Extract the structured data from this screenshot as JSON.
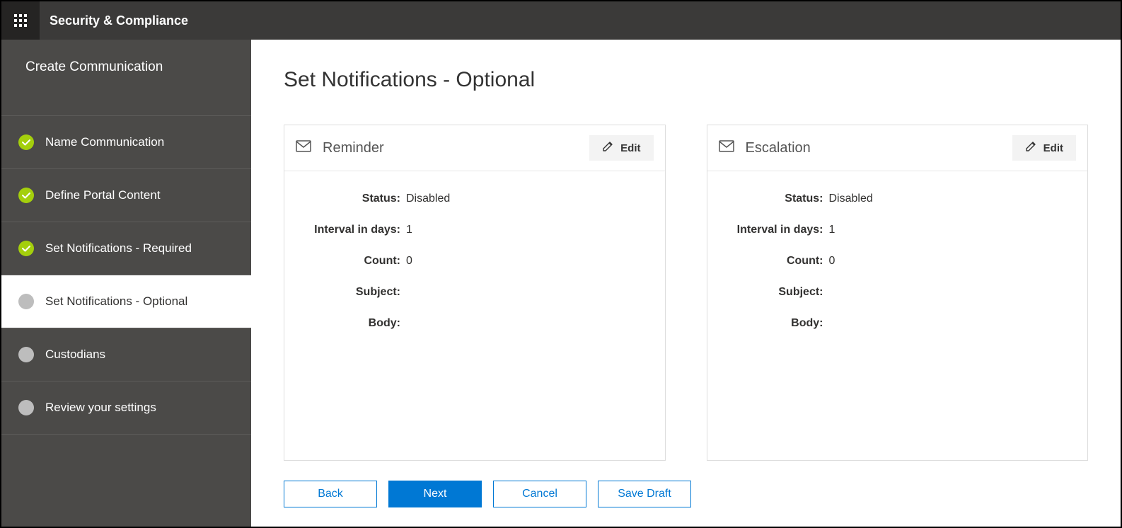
{
  "header": {
    "app_title": "Security & Compliance"
  },
  "sidebar": {
    "title": "Create Communication",
    "steps": [
      {
        "label": "Name Communication"
      },
      {
        "label": "Define Portal Content"
      },
      {
        "label": "Set Notifications - Required"
      },
      {
        "label": "Set Notifications - Optional"
      },
      {
        "label": "Custodians"
      },
      {
        "label": "Review your settings"
      }
    ]
  },
  "main": {
    "title": "Set Notifications - Optional",
    "cards": {
      "reminder": {
        "title": "Reminder",
        "edit_label": "Edit",
        "fields": {
          "status_label": "Status:",
          "status_value": "Disabled",
          "interval_label": "Interval in days:",
          "interval_value": "1",
          "count_label": "Count:",
          "count_value": "0",
          "subject_label": "Subject:",
          "subject_value": "",
          "body_label": "Body:",
          "body_value": ""
        }
      },
      "escalation": {
        "title": "Escalation",
        "edit_label": "Edit",
        "fields": {
          "status_label": "Status:",
          "status_value": "Disabled",
          "interval_label": "Interval in days:",
          "interval_value": "1",
          "count_label": "Count:",
          "count_value": "0",
          "subject_label": "Subject:",
          "subject_value": "",
          "body_label": "Body:",
          "body_value": ""
        }
      }
    },
    "buttons": {
      "back": "Back",
      "next": "Next",
      "cancel": "Cancel",
      "save_draft": "Save Draft"
    }
  }
}
